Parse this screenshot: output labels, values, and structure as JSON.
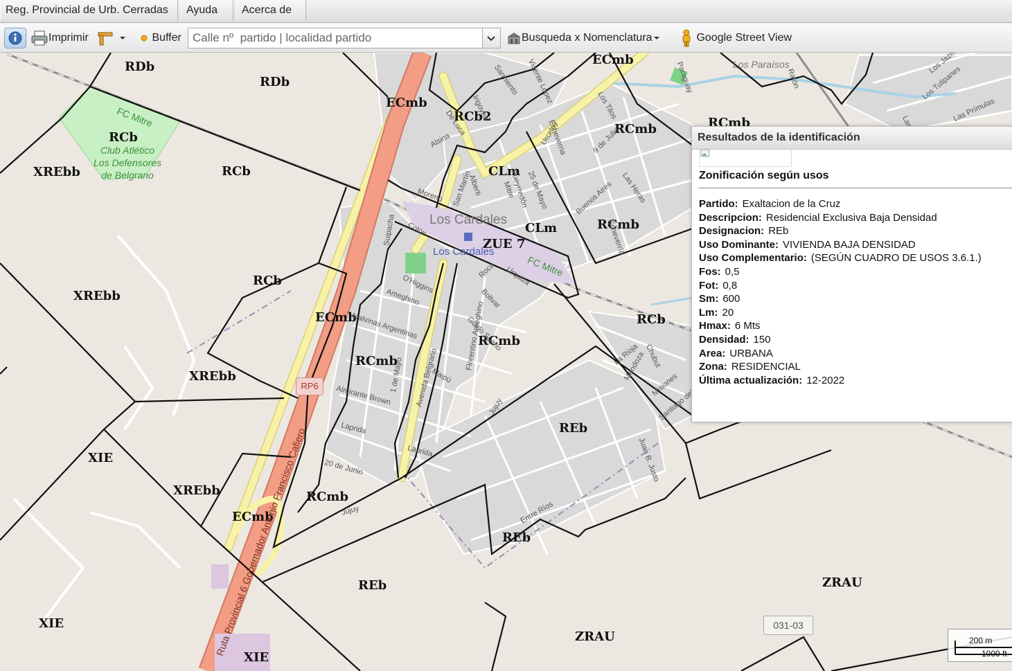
{
  "menu": {
    "tabs": [
      {
        "label": "Reg. Provincial de Urb. Cerradas"
      },
      {
        "label": "Ayuda"
      },
      {
        "label": "Acerca de"
      }
    ]
  },
  "toolbar": {
    "info_icon": "info-icon",
    "print_label": "Imprimir",
    "buffer_label": "Buffer",
    "search_placeholder": "Calle nº  partido | localidad partido",
    "nomenclatura_label": "Busqueda x Nomenclatura",
    "streetview_label": "Google Street View"
  },
  "map": {
    "zone_labels": [
      "RDb",
      "RDb",
      "ECmb",
      "RCb2",
      "RCb",
      "XREbb",
      "RCb",
      "ECmb",
      "RCmb",
      "RCmb",
      "CLm",
      "CLm",
      "RCmb",
      "ZUE 7",
      "RCb",
      "XREbb",
      "ECmb",
      "RCmb",
      "RCb",
      "RCmb",
      "XREbb",
      "REb",
      "XIE",
      "XREbb",
      "RCmb",
      "ECmb",
      "REb",
      "REb",
      "XIE",
      "ZRAU",
      "ZRAU",
      "XIE"
    ],
    "town_label": "Los Cardales",
    "station_label": "Los Cardales",
    "railway_label": "FC Mitre",
    "park_label": "Club Atlético\nLos Defensores\nde Belgrano",
    "district_label": "Los Paraísos",
    "street_labels": [
      "Alsina",
      "San Martín",
      "De Luca",
      "Alberti",
      "Mitre",
      "Pueyrredón",
      "25 de Mayo",
      "9 de Julio",
      "Irigoyen",
      "Sarmiento",
      "Vicente López",
      "Urcelay",
      "Echeverria",
      "Buenos Aires",
      "Los Tilos",
      "Las Heras",
      "Echeverría",
      "Colón",
      "Moreno",
      "Suipacha",
      "O'Higgins",
      "Ameghino",
      "Malvinas Argentinas",
      "Avenida Belgrano",
      "Roca",
      "Bolivar",
      "Guido Spano",
      "Florentino Ameghino",
      "Maipú",
      "1 de Mayo",
      "Almirante Brown",
      "Laprida",
      "Laprida",
      "20 de Junio",
      "Jujuy",
      "Jujuy",
      "Entre Ríos",
      "Juan B. Justo",
      "La Rioja",
      "Mendoza",
      "Chubut",
      "Misiones",
      "Santiago del Estero",
      "Urquiza",
      "Los Jazmines",
      "Los Tulipanes",
      "Las Azaleas",
      "Las Prímulas",
      "Ruta Provincial 6 Gobernador Antonio Francisco Cafiero",
      "Paraguay",
      "Ratón"
    ],
    "route_shield": "RP6",
    "road_ref": "031-03",
    "scale_metric": "200 m",
    "scale_imperial": "1000 ft"
  },
  "panel": {
    "title": "Resultados de la identificación",
    "subtitle": "Zonificación según usos",
    "fields": [
      {
        "label": "Partido:",
        "value": "Exaltacion de la Cruz"
      },
      {
        "label": "Descripcion:",
        "value": "Residencial Exclusiva Baja Densidad"
      },
      {
        "label": "Designacion:",
        "value": "REb"
      },
      {
        "label": "Uso Dominante:",
        "value": "VIVIENDA BAJA DENSIDAD"
      },
      {
        "label": "Uso Complementario:",
        "value": "(SEGÚN CUADRO DE USOS 3.6.1.)"
      },
      {
        "label": "Fos:",
        "value": "0,5"
      },
      {
        "label": "Fot:",
        "value": "0,8"
      },
      {
        "label": "Sm:",
        "value": "600"
      },
      {
        "label": "Lm:",
        "value": "20"
      },
      {
        "label": "Hmax:",
        "value": "6 Mts"
      },
      {
        "label": "Densidad:",
        "value": "150"
      },
      {
        "label": "Area:",
        "value": "URBANA"
      },
      {
        "label": "Zona:",
        "value": "RESIDENCIAL"
      },
      {
        "label": "Última actualización:",
        "value": "12-2022"
      }
    ]
  },
  "colors": {
    "primary_road": "#f29d84",
    "secondary_road": "#f7f2a7",
    "zone_border": "#111111",
    "urban_fill": "#d9d9d9",
    "park": "#c8f0c4",
    "water": "#a9d3e6",
    "rail": "#8e8e8e"
  }
}
